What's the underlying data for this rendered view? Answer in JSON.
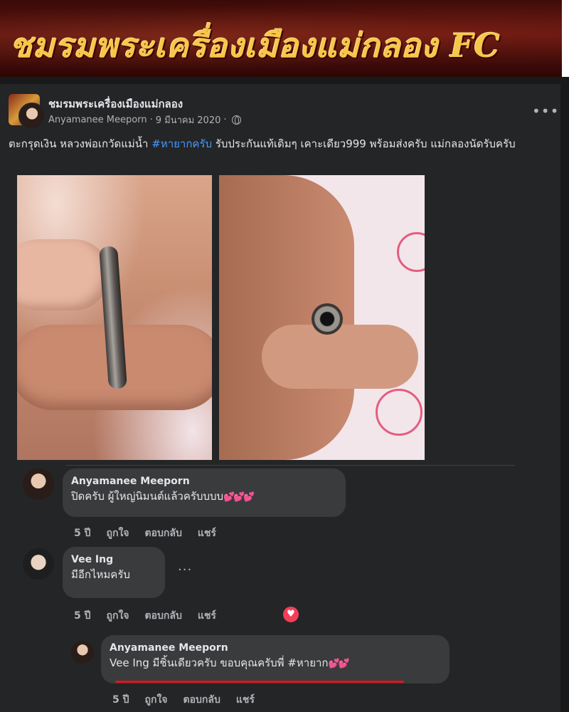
{
  "banner": {
    "title": "ชมรมพระเครื่องเมืองแม่กลอง FC"
  },
  "post": {
    "group_name": "ชมรมพระเครื่องเมืองแม่กลอง",
    "author": "Anyamanee Meeporn",
    "separator": "·",
    "date": "9 มีนาคม 2020",
    "separator2": "·",
    "more_icon": "more-horizontal-icon",
    "text_before": "ตะกรุดเงิน หลวงพ่อเกวัดแม่น้ำ ",
    "hashtag": "#หายากครับ",
    "text_after": " รับประกันแท้เดิมๆ เคาะเดียว999 พร้อมส่งครับ แม่กลองนัดรับครับ"
  },
  "comments": [
    {
      "name": "Anyamanee Meeporn",
      "text": "ปิดครับ ผู้ใหญ่นิมนต์แล้วครับบบบ",
      "hearts": "💕💕💕",
      "time": "5 ปี",
      "like": "ถูกใจ",
      "reply": "ตอบกลับ",
      "share": "แชร์"
    },
    {
      "name": "Vee Ing",
      "text": "มีอีกไหมครับ",
      "time": "5 ปี",
      "like": "ถูกใจ",
      "reply": "ตอบกลับ",
      "share": "แชร์",
      "reaction": "love-reaction-icon"
    },
    {
      "name": "Anyamanee Meeporn",
      "mention": "Vee Ing",
      "text": " มีชิ้นเดียวครับ ขอบคุณครับพี่ #หายาก",
      "hearts": "💕💕",
      "time": "5 ปี",
      "like": "ถูกใจ",
      "reply": "ตอบกลับ",
      "share": "แชร์"
    }
  ],
  "colors": {
    "background": "#18191a",
    "card": "#242526",
    "bubble": "#3a3b3c",
    "hashtag": "#4599ff",
    "underline": "#e0141e"
  }
}
